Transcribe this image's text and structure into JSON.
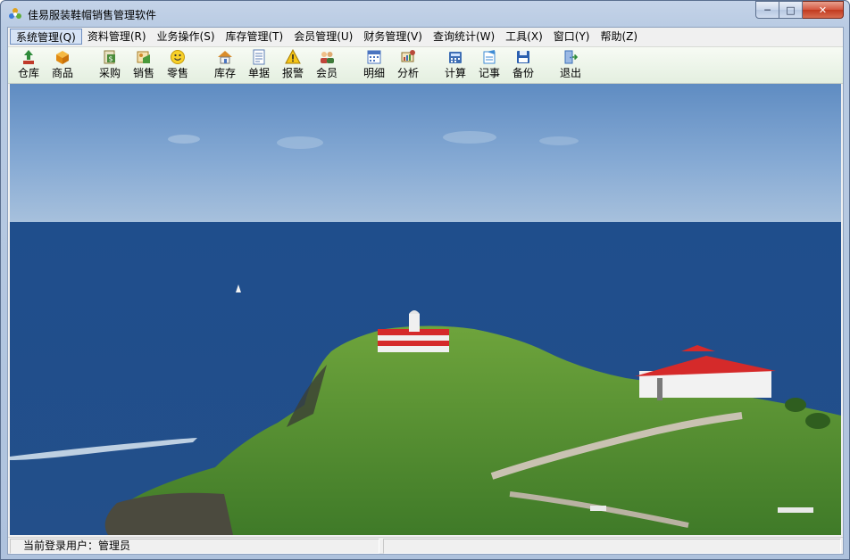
{
  "window": {
    "title": "佳易服装鞋帽销售管理软件"
  },
  "caption_buttons": {
    "minimize": "─",
    "maximize": "□",
    "close": "✕"
  },
  "menu": [
    {
      "label": "系统管理(Q)"
    },
    {
      "label": "资料管理(R)"
    },
    {
      "label": "业务操作(S)"
    },
    {
      "label": "库存管理(T)"
    },
    {
      "label": "会员管理(U)"
    },
    {
      "label": "财务管理(V)"
    },
    {
      "label": "查询统计(W)"
    },
    {
      "label": "工具(X)"
    },
    {
      "label": "窗口(Y)"
    },
    {
      "label": "帮助(Z)"
    }
  ],
  "toolbar": [
    {
      "label": "仓库",
      "icon": "warehouse-icon",
      "color": "#2e8b3a"
    },
    {
      "label": "商品",
      "icon": "goods-icon",
      "color": "#e39a1a"
    },
    {
      "label": "采购",
      "icon": "purchase-icon",
      "color": "#4a8c3a"
    },
    {
      "label": "销售",
      "icon": "sales-icon",
      "color": "#d08b2a"
    },
    {
      "label": "零售",
      "icon": "smiley-icon",
      "color": "#f2c318"
    },
    {
      "label": "库存",
      "icon": "home-icon",
      "color": "#d98c2b"
    },
    {
      "label": "单据",
      "icon": "document-icon",
      "color": "#5c7fb5"
    },
    {
      "label": "报警",
      "icon": "warning-icon",
      "color": "#f0c419"
    },
    {
      "label": "会员",
      "icon": "members-icon",
      "color": "#c0463b"
    },
    {
      "label": "明细",
      "icon": "calendar-icon",
      "color": "#4a74c0"
    },
    {
      "label": "分析",
      "icon": "analysis-icon",
      "color": "#b84a3a"
    },
    {
      "label": "计算",
      "icon": "calculator-icon",
      "color": "#3f6fb5"
    },
    {
      "label": "记事",
      "icon": "notepad-icon",
      "color": "#3d8bd4"
    },
    {
      "label": "备份",
      "icon": "floppy-icon",
      "color": "#2b5fb0"
    },
    {
      "label": "退出",
      "icon": "exit-icon",
      "color": "#3a6fb8"
    }
  ],
  "status": {
    "user_label": "当前登录用户：",
    "user": "管理员"
  }
}
